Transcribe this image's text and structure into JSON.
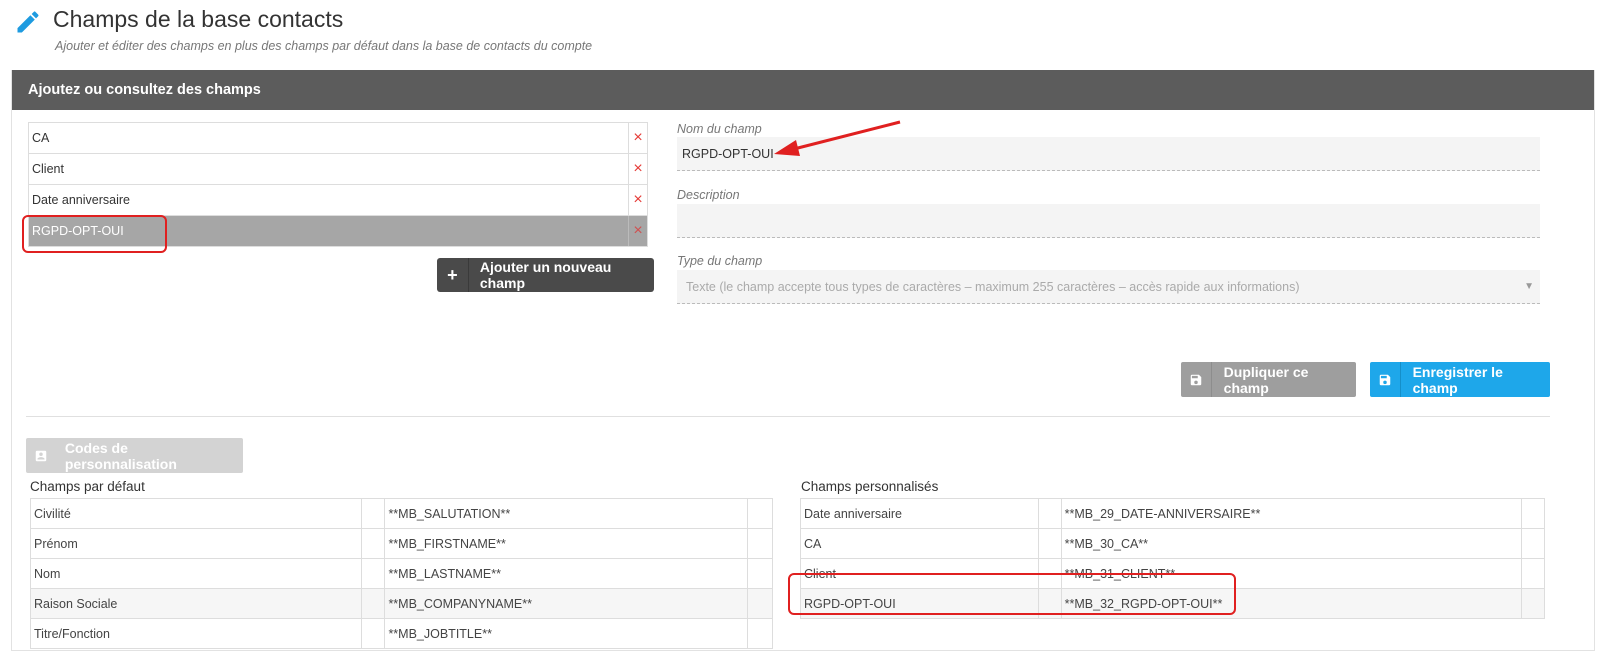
{
  "header": {
    "title": "Champs de la base contacts",
    "subtitle": "Ajouter et éditer des champs en plus des champs par défaut dans la base de contacts du compte"
  },
  "panel": {
    "title": "Ajoutez ou consultez des champs"
  },
  "fields": {
    "items": [
      {
        "label": "CA",
        "delete_glyph": "×"
      },
      {
        "label": "Client",
        "delete_glyph": "×"
      },
      {
        "label": "Date anniversaire",
        "delete_glyph": "×"
      },
      {
        "label": "RGPD-OPT-OUI",
        "delete_glyph": "×"
      }
    ],
    "selected_index": 3,
    "add_button": "Ajouter un nouveau champ"
  },
  "form": {
    "name_label": "Nom du champ",
    "name_value": "RGPD-OPT-OUI",
    "description_label": "Description",
    "description_value": "",
    "type_label": "Type du champ",
    "type_value": "Texte (le champ accepte tous types de caractères – maximum 255 caractères – accès rapide aux informations)",
    "duplicate_button": "Dupliquer ce champ",
    "save_button": "Enregistrer le champ"
  },
  "codes": {
    "button": "Codes de personnalisation",
    "default_title": "Champs par défaut",
    "default_rows": [
      {
        "name": "Civilité",
        "code": "**MB_SALUTATION**"
      },
      {
        "name": "Prénom",
        "code": "**MB_FIRSTNAME**"
      },
      {
        "name": "Nom",
        "code": "**MB_LASTNAME**"
      },
      {
        "name": "Raison Sociale",
        "code": "**MB_COMPANYNAME**"
      },
      {
        "name": "Titre/Fonction",
        "code": "**MB_JOBTITLE**"
      }
    ],
    "custom_title": "Champs personnalisés",
    "custom_rows": [
      {
        "name": "Date anniversaire",
        "code": "**MB_29_DATE-ANNIVERSAIRE**"
      },
      {
        "name": "CA",
        "code": "**MB_30_CA**"
      },
      {
        "name": "Client",
        "code": "**MB_31_CLIENT**"
      },
      {
        "name": "RGPD-OPT-OUI",
        "code": "**MB_32_RGPD-OPT-OUI**"
      }
    ]
  },
  "colors": {
    "header_bar": "#5c5c5c",
    "accent_blue": "#1ea7ea",
    "delete_red": "#e53935",
    "annotation_red": "#e02020",
    "selected_row": "#a6a6a6"
  },
  "icons": {
    "page": "pencil-icon",
    "add": "plus-icon",
    "save": "floppy-disk-icon",
    "codes": "contact-card-icon",
    "select": "caret-down-icon"
  }
}
